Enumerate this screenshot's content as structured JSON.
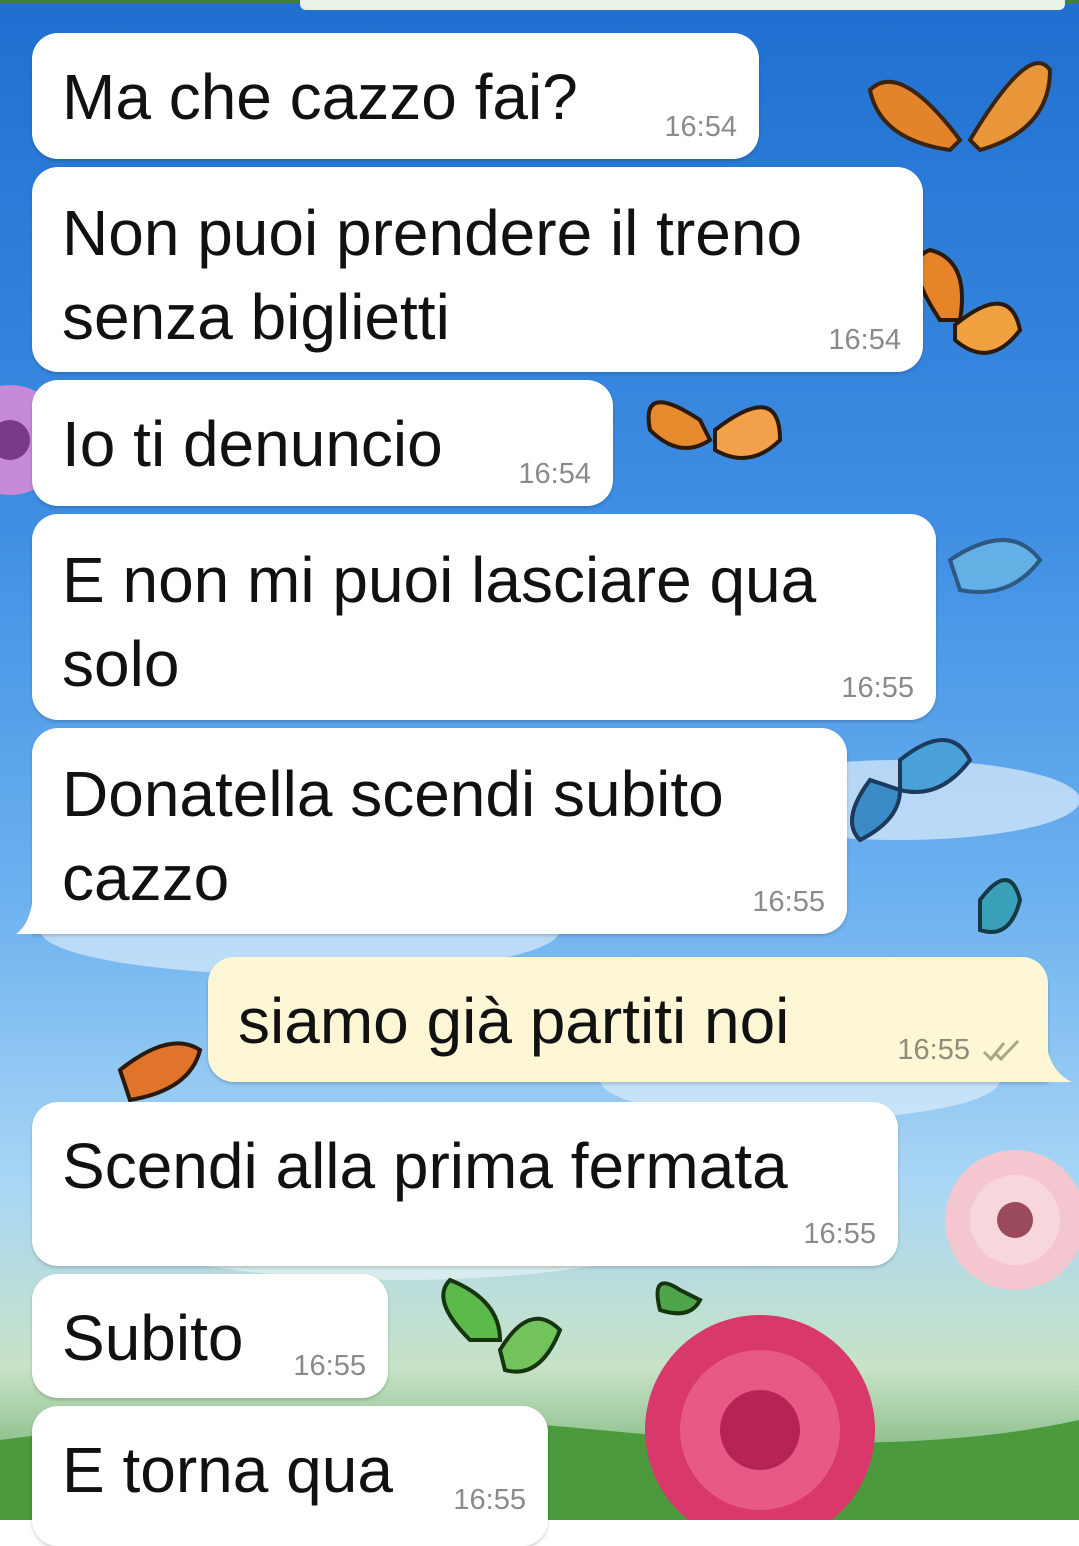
{
  "chat": {
    "messages": [
      {
        "text": "Ma che cazzo fai?",
        "time": "16:54",
        "direction": "in"
      },
      {
        "text": "Non puoi prendere il treno\nsenza biglietti",
        "time": "16:54",
        "direction": "in"
      },
      {
        "text": "Io ti denuncio",
        "time": "16:54",
        "direction": "in"
      },
      {
        "text": "E non mi puoi lasciare qua\nsolo",
        "time": "16:55",
        "direction": "in"
      },
      {
        "text": "Donatella scendi subito\ncazzo",
        "time": "16:55",
        "direction": "in"
      },
      {
        "text": "siamo già partiti noi",
        "time": "16:55",
        "direction": "out",
        "status_icon": "double-check-icon"
      },
      {
        "text": "Scendi alla prima fermata",
        "time": "16:55",
        "direction": "in"
      },
      {
        "text": "Subito",
        "time": "16:55",
        "direction": "in"
      },
      {
        "text": "E torna qua",
        "time": "16:55",
        "direction": "in"
      }
    ]
  },
  "wallpaper": {
    "description_icon": "butterflies-wallpaper",
    "sky_color": "#3f8fe4"
  },
  "colors": {
    "incoming_bubble": "#ffffff",
    "outgoing_bubble": "#fdf7d6",
    "timestamp": "#8a8a8a",
    "read_ticks": "#a7a78a"
  }
}
